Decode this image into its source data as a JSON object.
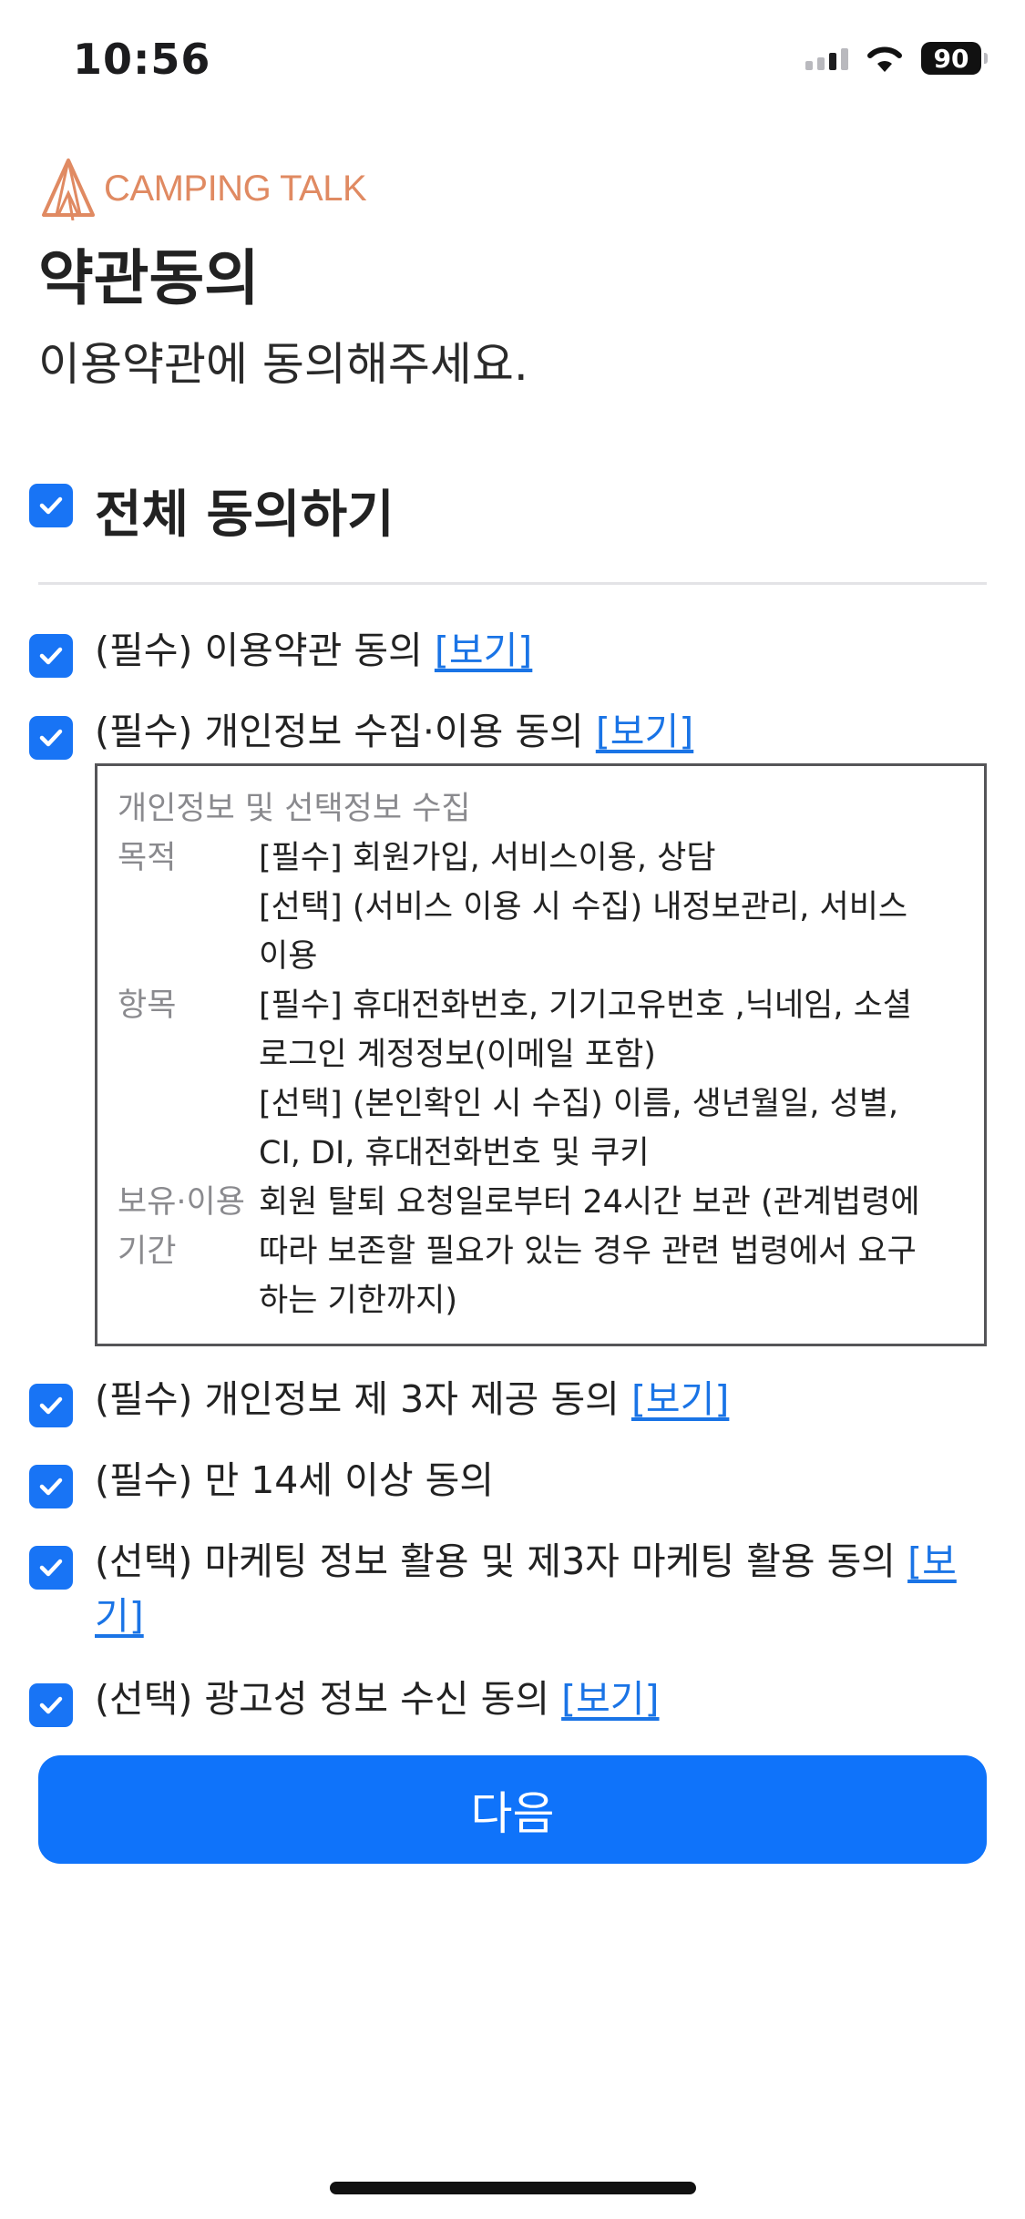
{
  "status_bar": {
    "time": "10:56",
    "battery": "90"
  },
  "header": {
    "logo_text": "CAMPING TALK",
    "title": "약관동의",
    "subtitle": "이용약관에 동의해주세요."
  },
  "all_agree": {
    "label": "전체 동의하기",
    "checked": true
  },
  "items": [
    {
      "label": "(필수) 이용약관 동의",
      "link": "[보기]",
      "checked": true
    },
    {
      "label": "(필수) 개인정보 수집·이용 동의",
      "link": "[보기]",
      "checked": true
    },
    {
      "label": "(필수) 개인정보 제 3자 제공 동의",
      "link": "[보기]",
      "checked": true
    },
    {
      "label": "(필수) 만 14세 이상 동의",
      "checked": true
    },
    {
      "label": "(선택) 마케팅 정보 활용 및 제3자 마케팅 활용 동의",
      "link": "[보기]",
      "checked": true
    },
    {
      "label": "(선택) 광고성 정보 수신 동의",
      "link": "[보기]",
      "checked": true
    }
  ],
  "privacy_detail": {
    "heading": "개인정보 및 선택정보 수집",
    "rows": [
      {
        "key": "목적",
        "lines": [
          "[필수] 회원가입, 서비스이용, 상담",
          "[선택] (서비스 이용 시 수집) 내정보관리, 서비스",
          "이용"
        ]
      },
      {
        "key": "항목",
        "lines": [
          "[필수] 휴대전화번호, 기기고유번호 ,닉네임, 소셜",
          "로그인 계정정보(이메일 포함)",
          "[선택] (본인확인 시 수집) 이름, 생년월일, 성별,",
          "CI, DI, 휴대전화번호 및 쿠키"
        ]
      },
      {
        "key_lines": [
          "보유·이용",
          "기간"
        ],
        "lines": [
          "회원 탈퇴 요청일로부터 24시간 보관 (관계법령에",
          "따라 보존할 필요가 있는 경우 관련 법령에서 요구",
          "하는 기한까지)"
        ]
      }
    ]
  },
  "next_button": {
    "label": "다음"
  },
  "colors": {
    "accent": "#1874f5",
    "button": "#0f73fa",
    "link": "#1a74e6",
    "logo": "#e08a62"
  },
  "icons": {
    "checkbox": "checkbox-checked-icon",
    "logo": "tent-icon"
  }
}
